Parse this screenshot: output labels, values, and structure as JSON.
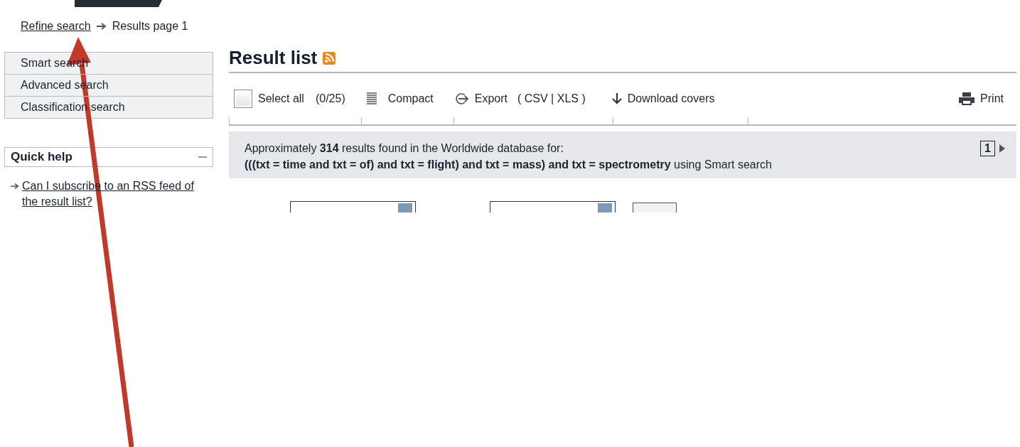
{
  "breadcrumb": {
    "link": "Refine search",
    "current": "Results page 1"
  },
  "search_menu": {
    "items": [
      "Smart search",
      "Advanced search",
      "Classification search"
    ]
  },
  "quick_help": {
    "title": "Quick help",
    "expanded": true,
    "links": [
      "Can I subscribe to an RSS feed of the result list?"
    ]
  },
  "result_list": {
    "title": "Result list",
    "toolbar": {
      "select_all": {
        "label": "Select all",
        "checked": false
      },
      "count": "(0/25)",
      "compact": "Compact",
      "export": "Export",
      "formats": "( CSV | XLS )",
      "download": "Download covers",
      "print": "Print"
    },
    "summary": [
      "Approximately **314** results found in the Worldwide database for:",
      "**(((txt = time and txt = of) and txt = flight) and txt = mass) and txt = spectrometry** using Smart search"
    ],
    "pager": {
      "page": "1"
    }
  }
}
